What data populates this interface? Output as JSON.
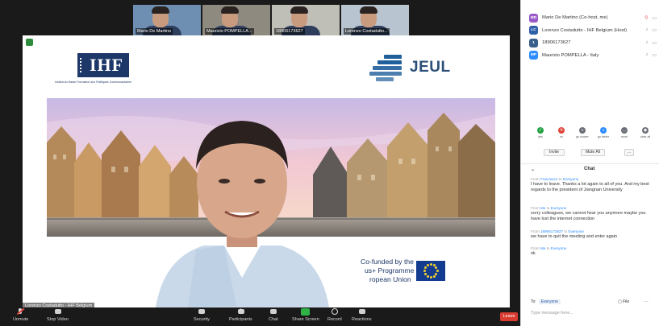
{
  "participants_strip": [
    {
      "name": "Mario De Martino",
      "bg": "#6f8fb2"
    },
    {
      "name": "Maurizio POMPELLA...",
      "bg": "#8e8a80"
    },
    {
      "name": "18906173627",
      "bg": "#bfbfb8"
    },
    {
      "name": "Lorenzo Costadutto...",
      "bg": "#b8c4cf"
    }
  ],
  "slide": {
    "ihf_logo_text": "IHF",
    "ihf_subtitle": "Institut du Haute Formation aux Politiques Communautaires",
    "jeul_logo_text": "JEUL",
    "cofund_lines": [
      "Co-funded by the",
      "us+ Programme",
      "ropean Union"
    ]
  },
  "overlay_name": "Lorenzo Costadutto - IHF Belgium",
  "toolbar": {
    "items": [
      {
        "label": "Unmute",
        "icon": "microphone-muted-icon"
      },
      {
        "label": "Stop Video",
        "icon": "video-camera-icon"
      },
      {
        "label": "Security",
        "icon": "shield-icon"
      },
      {
        "label": "Participants",
        "icon": "participants-icon",
        "count": "4"
      },
      {
        "label": "Chat",
        "icon": "chat-bubble-icon"
      },
      {
        "label": "Share Screen",
        "icon": "share-screen-icon"
      },
      {
        "label": "Record",
        "icon": "record-icon"
      },
      {
        "label": "Reactions",
        "icon": "smiley-icon"
      }
    ],
    "leave_label": "Leave"
  },
  "participants_panel": [
    {
      "initials": "MD",
      "name": "Mario De Martino (Co-host, me)",
      "color": "#9a5ac7",
      "mic_muted": true
    },
    {
      "initials": "LC",
      "name": "Lorenzo Costadutto - IHF Belgium (Host)",
      "color": "#2f5fa8",
      "mic_muted": false
    },
    {
      "initials": "1",
      "name": "18906173627",
      "color": "#3a5f8a",
      "mic_muted": false
    },
    {
      "initials": "MP",
      "name": "Maurizio POMPELLA - Italy",
      "color": "#2d8cff",
      "mic_muted": false
    }
  ],
  "reactions": [
    {
      "label": "yes",
      "color": "#25a244",
      "glyph": "✓"
    },
    {
      "label": "no",
      "color": "#e0433b",
      "glyph": "✕"
    },
    {
      "label": "go slower",
      "color": "#6d6f78",
      "glyph": "«"
    },
    {
      "label": "go faster",
      "color": "#2d8cff",
      "glyph": "»"
    },
    {
      "label": "more",
      "color": "#6d6f78",
      "glyph": "…"
    },
    {
      "label": "clear all",
      "color": "#6d6f78",
      "glyph": "◆"
    }
  ],
  "panel_buttons": {
    "invite": "Invite",
    "mute_all": "Mute All",
    "more": "..."
  },
  "chat": {
    "title": "Chat",
    "messages": [
      {
        "from": "Francesco",
        "to": "Everyone",
        "text": "I have to leave. Thanks a lot again to all of you. And my best regards to the president of Jiangnan University"
      },
      {
        "from": "Me",
        "to": "Everyone",
        "text": "sorry colleagues, we cannot hear you anymore maybe you have lost the internet connection"
      },
      {
        "from": "18906173627",
        "to": "Everyone",
        "text": "we have to quit the meeting and enter again"
      },
      {
        "from": "Me",
        "to": "Everyone",
        "text": "ok"
      }
    ],
    "to_label": "To:",
    "to_value": "Everyone",
    "file_label": "File",
    "more_label": "···",
    "input_placeholder": "Type message here..."
  }
}
